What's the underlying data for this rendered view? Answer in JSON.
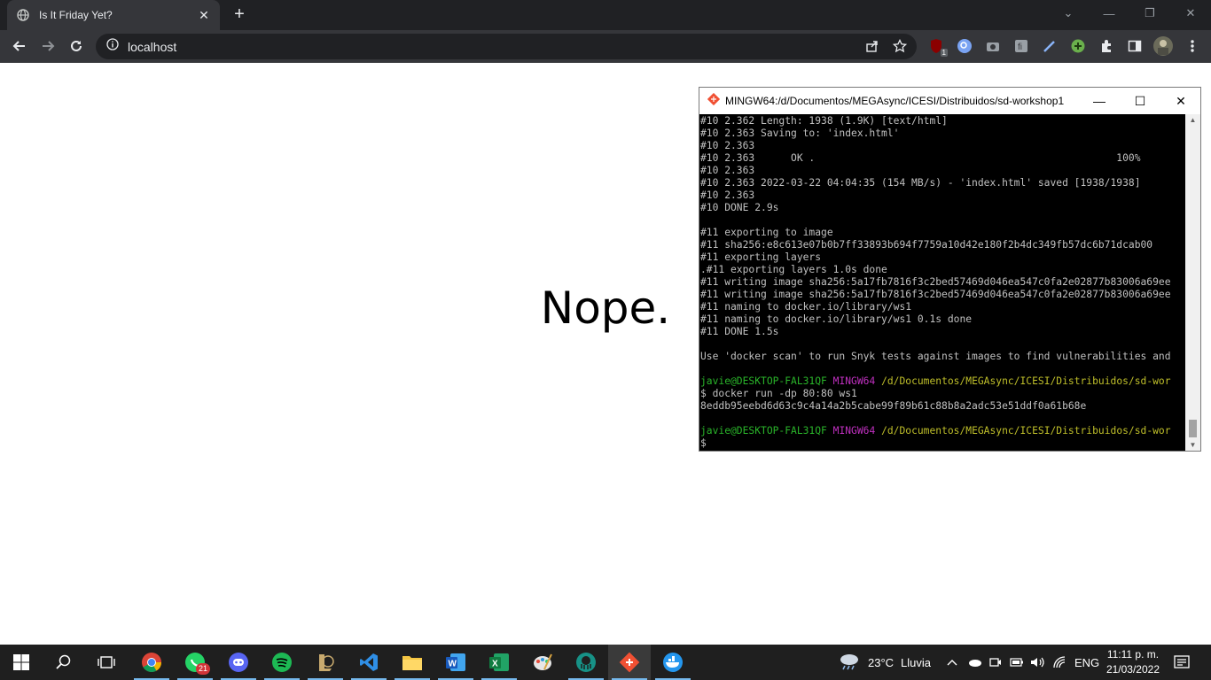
{
  "browser": {
    "tab_title": "Is It Friday Yet?",
    "tab_close": "✕",
    "new_tab": "+",
    "url": "localhost",
    "window_controls": [
      "⌄",
      "—",
      "❐",
      "✕"
    ],
    "extension_badge": "1"
  },
  "page": {
    "message": "Nope."
  },
  "terminal": {
    "title": "MINGW64:/d/Documentos/MEGAsync/ICESI/Distribuidos/sd-workshop1",
    "buttons": [
      "—",
      "☐",
      "✕"
    ],
    "lines": [
      "#10 2.362 Length: 1938 (1.9K) [text/html]",
      "#10 2.363 Saving to: 'index.html'",
      "#10 2.363",
      "#10 2.363      OK .                                                  100%",
      "#10 2.363",
      "#10 2.363 2022-03-22 04:04:35 (154 MB/s) - 'index.html' saved [1938/1938]",
      "#10 2.363",
      "#10 DONE 2.9s",
      "",
      "#11 exporting to image",
      "#11 sha256:e8c613e07b0b7ff33893b694f7759a10d42e180f2b4dc349fb57dc6b71dcab00",
      "#11 exporting layers",
      ".#11 exporting layers 1.0s done",
      "#11 writing image sha256:5a17fb7816f3c2bed57469d046ea547c0fa2e02877b83006a69ee",
      "#11 writing image sha256:5a17fb7816f3c2bed57469d046ea547c0fa2e02877b83006a69ee",
      "#11 naming to docker.io/library/ws1",
      "#11 naming to docker.io/library/ws1 0.1s done",
      "#11 DONE 1.5s",
      "",
      "Use 'docker scan' to run Snyk tests against images to find vulnerabilities and",
      ""
    ],
    "prompt1": {
      "user": "javie@DESKTOP-FAL31QF",
      "shell": "MINGW64",
      "path": "/d/Documentos/MEGAsync/ICESI/Distribuidos/sd-wor"
    },
    "command": "$ docker run -dp 80:80 ws1",
    "container_id": "8eddb95eebd6d63c9c4a14a2b5cabe99f89b61c88b8a2adc53e51ddf0a61b68e",
    "prompt2": {
      "user": "javie@DESKTOP-FAL31QF",
      "shell": "MINGW64",
      "path": "/d/Documentos/MEGAsync/ICESI/Distribuidos/sd-wor"
    },
    "cursor_prompt": "$"
  },
  "taskbar": {
    "apps": [
      {
        "name": "chrome",
        "icon": "chrome-icon"
      },
      {
        "name": "whatsapp",
        "icon": "whatsapp-icon",
        "badge": "21"
      },
      {
        "name": "discord",
        "icon": "discord-icon"
      },
      {
        "name": "spotify",
        "icon": "spotify-icon"
      },
      {
        "name": "league",
        "icon": "league-icon"
      },
      {
        "name": "vscode",
        "icon": "vscode-icon"
      },
      {
        "name": "explorer",
        "icon": "folder-icon"
      },
      {
        "name": "word",
        "icon": "word-icon"
      },
      {
        "name": "excel",
        "icon": "excel-icon"
      },
      {
        "name": "paint",
        "icon": "palette-icon"
      },
      {
        "name": "gitkraken",
        "icon": "gitkraken-icon"
      },
      {
        "name": "git-bash",
        "icon": "git-icon"
      },
      {
        "name": "docker",
        "icon": "docker-icon"
      }
    ],
    "weather_temp": "23°C",
    "weather_text": "Lluvia",
    "language": "ENG",
    "time": "11:11 p. m.",
    "date": "21/03/2022"
  },
  "colors": {
    "tab_bg": "#35363a",
    "frame_bg": "#202124",
    "term_green": "#2ab52a",
    "term_magenta": "#c030c0",
    "term_yellow": "#bfbf2a"
  }
}
